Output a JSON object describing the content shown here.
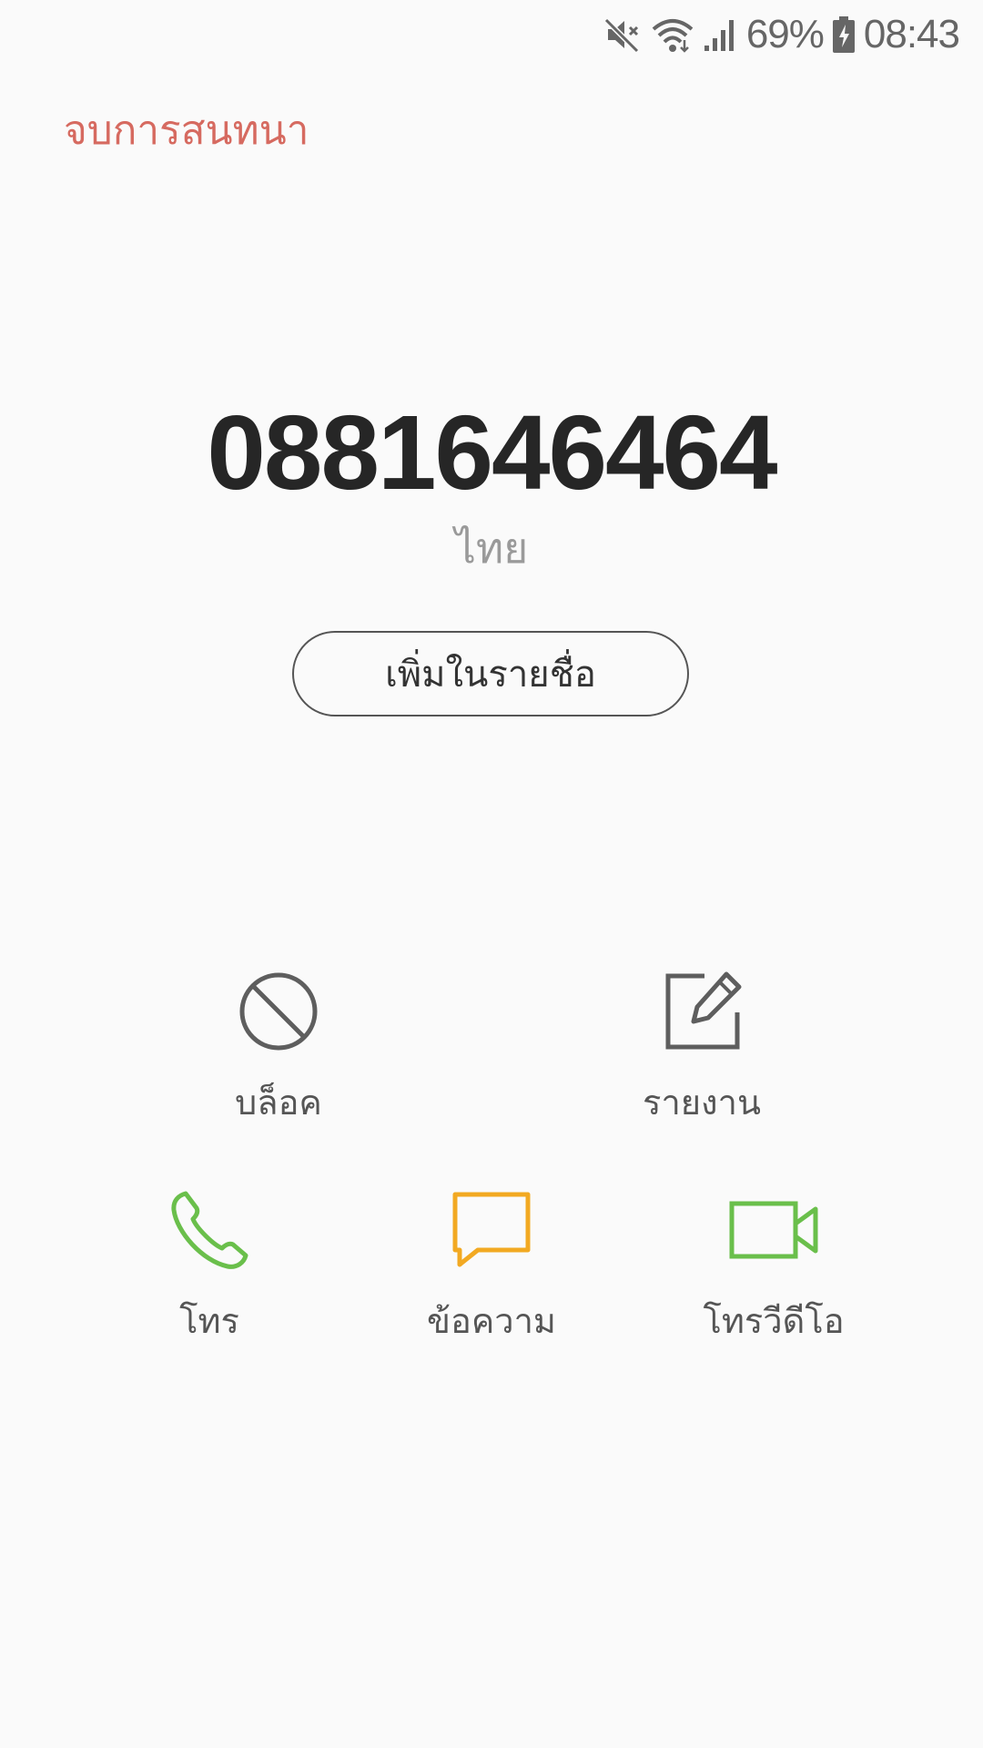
{
  "status_bar": {
    "icons": [
      "mute-icon",
      "wifi-icon",
      "signal-icon",
      "battery-charging-icon"
    ],
    "battery_percent": "69%",
    "time": "08:43"
  },
  "header": {
    "end_chat_label": "จบการสนทนา",
    "end_chat_color": "#d66a60"
  },
  "contact": {
    "phone_number": "0881646464",
    "country": "ไทย",
    "add_to_contacts_label": "เพิ่มในรายชื่อ"
  },
  "actions_row1": [
    {
      "label": "บล็อค",
      "icon": "block-icon"
    },
    {
      "label": "รายงาน",
      "icon": "report-edit-icon"
    }
  ],
  "actions_row2": [
    {
      "label": "โทร",
      "icon": "phone-icon",
      "color": "#6abf4b"
    },
    {
      "label": "ข้อความ",
      "icon": "message-icon",
      "color": "#f2a922"
    },
    {
      "label": "โทรวีดีโอ",
      "icon": "video-call-icon",
      "color": "#6abf4b"
    }
  ]
}
